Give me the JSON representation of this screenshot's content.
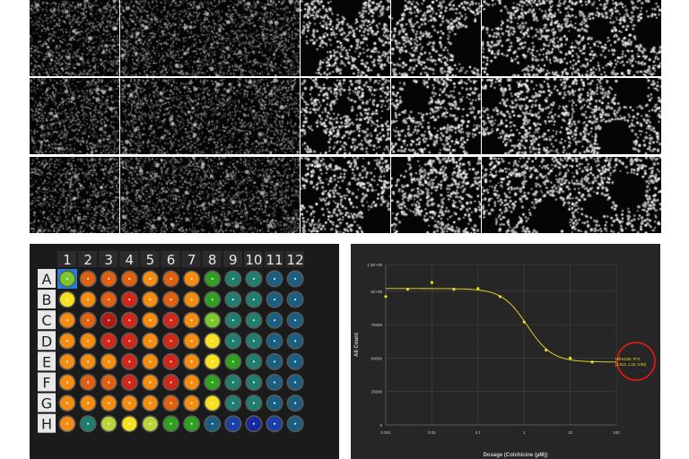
{
  "micrographs": {
    "rows": 3,
    "cols": 7,
    "tiles": [
      {
        "row": 0,
        "col": 0,
        "texture": "dense-fine"
      },
      {
        "row": 0,
        "col": 1,
        "texture": "dense-fine"
      },
      {
        "row": 0,
        "col": 2,
        "texture": "dense-fine"
      },
      {
        "row": 0,
        "col": 3,
        "texture": "sparse-round"
      },
      {
        "row": 0,
        "col": 4,
        "texture": "sparse-round"
      },
      {
        "row": 0,
        "col": 5,
        "texture": "sparse-round"
      },
      {
        "row": 0,
        "col": 6,
        "texture": "sparse-round"
      },
      {
        "row": 1,
        "col": 0,
        "texture": "dense-fine"
      },
      {
        "row": 1,
        "col": 1,
        "texture": "dense-fine"
      },
      {
        "row": 1,
        "col": 2,
        "texture": "dense-fine"
      },
      {
        "row": 1,
        "col": 3,
        "texture": "sparse-round"
      },
      {
        "row": 1,
        "col": 4,
        "texture": "sparse-round"
      },
      {
        "row": 1,
        "col": 5,
        "texture": "sparse-round"
      },
      {
        "row": 1,
        "col": 6,
        "texture": "sparse-round"
      },
      {
        "row": 2,
        "col": 0,
        "texture": "dense-fine"
      },
      {
        "row": 2,
        "col": 1,
        "texture": "dense-fine"
      },
      {
        "row": 2,
        "col": 2,
        "texture": "dense-fine"
      },
      {
        "row": 2,
        "col": 3,
        "texture": "sparse-round"
      },
      {
        "row": 2,
        "col": 4,
        "texture": "sparse-round"
      },
      {
        "row": 2,
        "col": 5,
        "texture": "sparse-round"
      },
      {
        "row": 2,
        "col": 6,
        "texture": "sparse-round"
      }
    ]
  },
  "plate": {
    "column_labels": [
      "1",
      "2",
      "3",
      "4",
      "5",
      "6",
      "7",
      "8",
      "9",
      "10",
      "11",
      "12"
    ],
    "row_labels": [
      "A",
      "B",
      "C",
      "D",
      "E",
      "F",
      "G",
      "H"
    ],
    "selected_well": "A1",
    "palette": {
      "g": "#30a020",
      "lg": "#7ac82a",
      "yg": "#b8d63a",
      "y": "#f6e020",
      "ly": "#f8ea40",
      "yo": "#f4b418",
      "o": "#f48c10",
      "do": "#e06010",
      "r": "#d02818",
      "dr": "#b01a10",
      "tg": "#1f7e6e",
      "tb": "#1a5e82",
      "b": "#1a40a8",
      "db": "#1828a0"
    },
    "wells": [
      [
        "lg",
        "do",
        "do",
        "do",
        "o",
        "do",
        "o",
        "g",
        "tg",
        "tg",
        "tb",
        "tb"
      ],
      [
        "y",
        "o",
        "do",
        "r",
        "o",
        "do",
        "o",
        "g",
        "tg",
        "tg",
        "tb",
        "tb"
      ],
      [
        "o",
        "do",
        "dr",
        "r",
        "o",
        "r",
        "o",
        "lg",
        "tg",
        "tg",
        "tb",
        "tb"
      ],
      [
        "o",
        "o",
        "r",
        "r",
        "o",
        "r",
        "o",
        "y",
        "tg",
        "tg",
        "tb",
        "tb"
      ],
      [
        "o",
        "o",
        "o",
        "r",
        "o",
        "r",
        "o",
        "y",
        "g",
        "tg",
        "tb",
        "tb"
      ],
      [
        "o",
        "do",
        "do",
        "r",
        "o",
        "r",
        "o",
        "g",
        "tg",
        "tg",
        "tb",
        "tb"
      ],
      [
        "o",
        "o",
        "o",
        "o",
        "o",
        "do",
        "o",
        "y",
        "tg",
        "tg",
        "tb",
        "tb"
      ],
      [
        "o",
        "tg",
        "yg",
        "y",
        "yg",
        "g",
        "g",
        "tb",
        "b",
        "db",
        "b",
        "tb"
      ]
    ]
  },
  "chart_data": {
    "type": "scatter",
    "xscale": "log",
    "xlim": [
      0.001,
      100
    ],
    "ylim": [
      0,
      120000
    ],
    "x_ticks": [
      0.001,
      0.01,
      0.1,
      1,
      10,
      100
    ],
    "x_tick_labels": [
      "0.001",
      "0.01",
      "0.1",
      "1",
      "10",
      "100"
    ],
    "y_ticks": [
      0,
      25000,
      50000,
      75000,
      100000,
      120000
    ],
    "y_tick_labels": [
      "0",
      "25000",
      "50000",
      "75000",
      "1E+05",
      "1.2E+05"
    ],
    "xlabel": "Dosage (Colchicine (µM))",
    "ylabel": "All Count",
    "grid": true,
    "points": [
      {
        "x": 0.001,
        "y": 96000
      },
      {
        "x": 0.003,
        "y": 101500
      },
      {
        "x": 0.01,
        "y": 106500
      },
      {
        "x": 0.03,
        "y": 101500
      },
      {
        "x": 0.1,
        "y": 102000
      },
      {
        "x": 0.3,
        "y": 96000
      },
      {
        "x": 1,
        "y": 77000
      },
      {
        "x": 3,
        "y": 56000
      },
      {
        "x": 10,
        "y": 50000
      },
      {
        "x": 30,
        "y": 47000
      }
    ],
    "fit": {
      "top": 102000,
      "bottom": 47000,
      "ec50": 1.16,
      "hill": -1.6
    },
    "annotation": {
      "line1": "Hill EC50, R^2:",
      "line2": "[1.614, 1.16, 0.99]",
      "circle_color": "#e01818",
      "text_color": "#e8e020"
    },
    "colors": {
      "points": "#f0e020",
      "fit": "#f0e020",
      "grid": "#444444",
      "text": "#cccccc"
    }
  }
}
